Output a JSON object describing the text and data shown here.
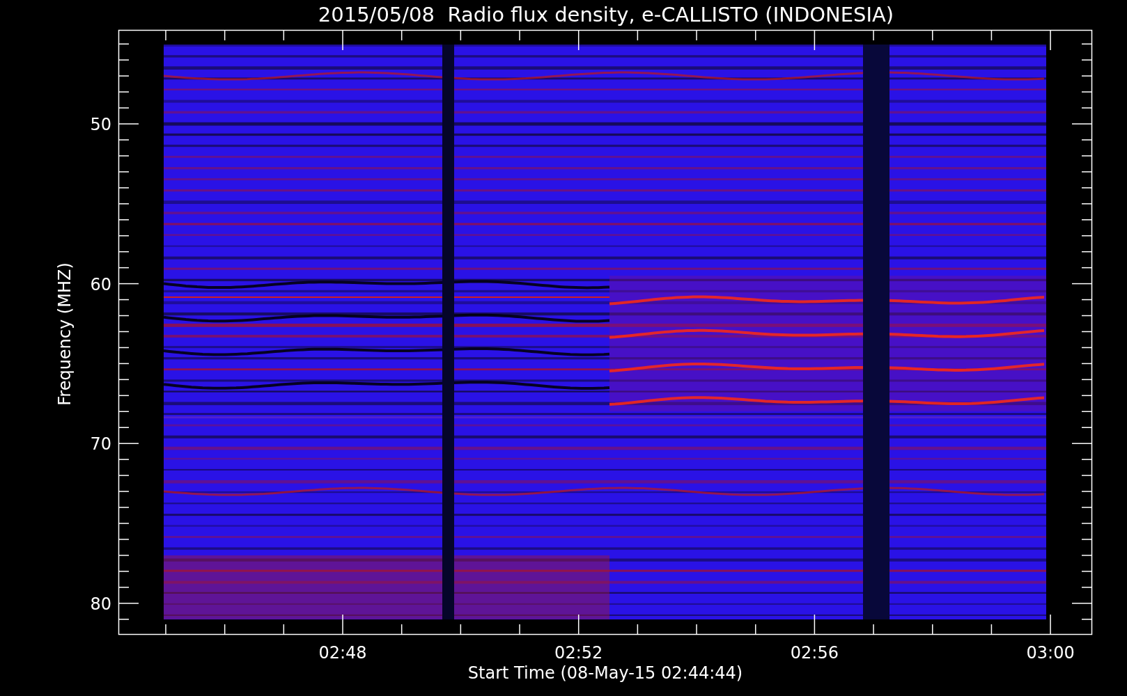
{
  "title": "2015/05/08  Radio flux density, e-CALLISTO (INDONESIA)",
  "y_axis": {
    "label": "Frequency (MHZ)",
    "ticks": [
      "50",
      "60",
      "70",
      "80"
    ]
  },
  "x_axis": {
    "label": "Start Time (08-May-15 02:44:44)",
    "ticks": [
      "02:48",
      "02:52",
      "02:56",
      "03:00"
    ]
  }
}
